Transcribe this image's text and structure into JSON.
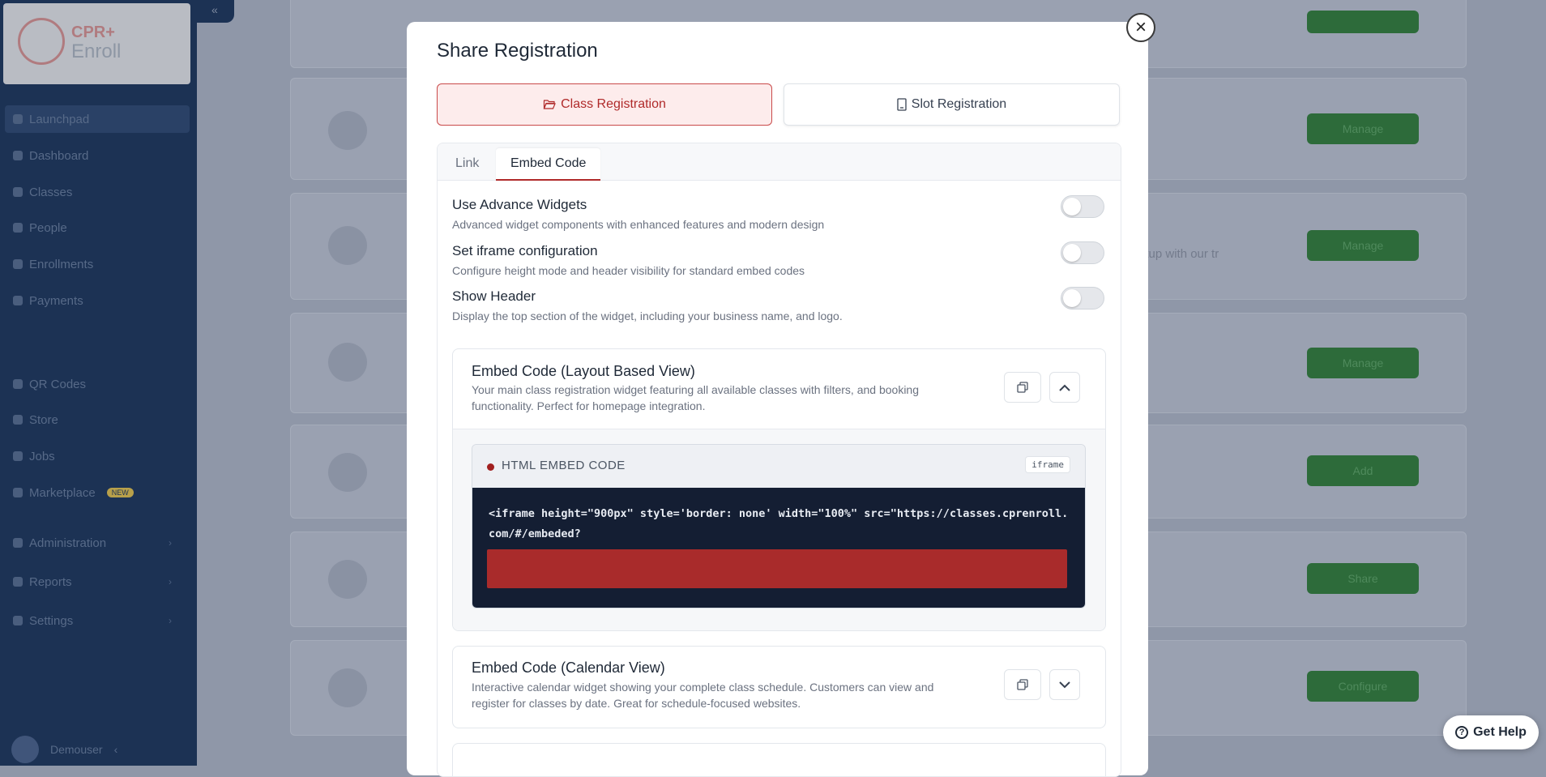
{
  "background": {
    "sidebar_items": [
      {
        "label": "Launchpad"
      },
      {
        "label": "Dashboard"
      },
      {
        "label": "Classes"
      },
      {
        "label": "People"
      },
      {
        "label": "Enrollments"
      },
      {
        "label": "Payments"
      },
      {
        "label": "QR Codes"
      },
      {
        "label": "Store"
      },
      {
        "label": "Jobs"
      },
      {
        "label": "Marketplace",
        "badge": "NEW"
      },
      {
        "label": "Administration"
      },
      {
        "label": "Reports"
      },
      {
        "label": "Settings"
      }
    ],
    "user_name": "Demouser",
    "card_buttons": [
      "Manage",
      "Manage",
      "Manage",
      "Add",
      "Share",
      "Configure"
    ],
    "card_desc_fragment": "Setup with our tr"
  },
  "modal": {
    "title": "Share Registration",
    "close_symbol": "×",
    "reg_tabs": {
      "class_label": "Class Registration",
      "slot_label": "Slot Registration"
    },
    "tabs": {
      "link": "Link",
      "embed": "Embed Code"
    },
    "settings": [
      {
        "title": "Use Advance Widgets",
        "desc": "Advanced widget components with enhanced features and modern design",
        "on": false
      },
      {
        "title": "Set iframe configuration",
        "desc": "Configure height mode and header visibility for standard embed codes",
        "on": false
      },
      {
        "title": "Show Header",
        "desc": "Display the top section of the widget, including your business name, and logo.",
        "on": false
      }
    ],
    "embed_layout": {
      "title": "Embed Code (Layout Based View)",
      "desc": "Your main class registration widget featuring all available classes with filters, and booking functionality. Perfect for homepage integration.",
      "code_label": "HTML EMBED CODE",
      "code_tag": "iframe",
      "code": "<iframe height=\"900px\" style='border: none' width=\"100%\" src=\"https://classes.cprenroll.com/#/embeded?"
    },
    "embed_calendar": {
      "title": "Embed Code (Calendar View)",
      "desc": "Interactive calendar widget showing your complete class schedule. Customers can view and register for classes by date. Great for schedule-focused websites."
    }
  },
  "help": {
    "label": "Get Help"
  },
  "icons": {
    "folder": "folder-open-icon",
    "slot": "bookmark-icon",
    "copy": "copy-icon",
    "chevron_up": "chevron-up-icon",
    "chevron_down": "chevron-down-icon",
    "close": "close-icon",
    "help": "question-circle-icon"
  },
  "colors": {
    "accent": "#b02a2a",
    "sidebar": "#1c3254",
    "manage_button": "#2d6b3a",
    "code_background": "#141e33"
  }
}
